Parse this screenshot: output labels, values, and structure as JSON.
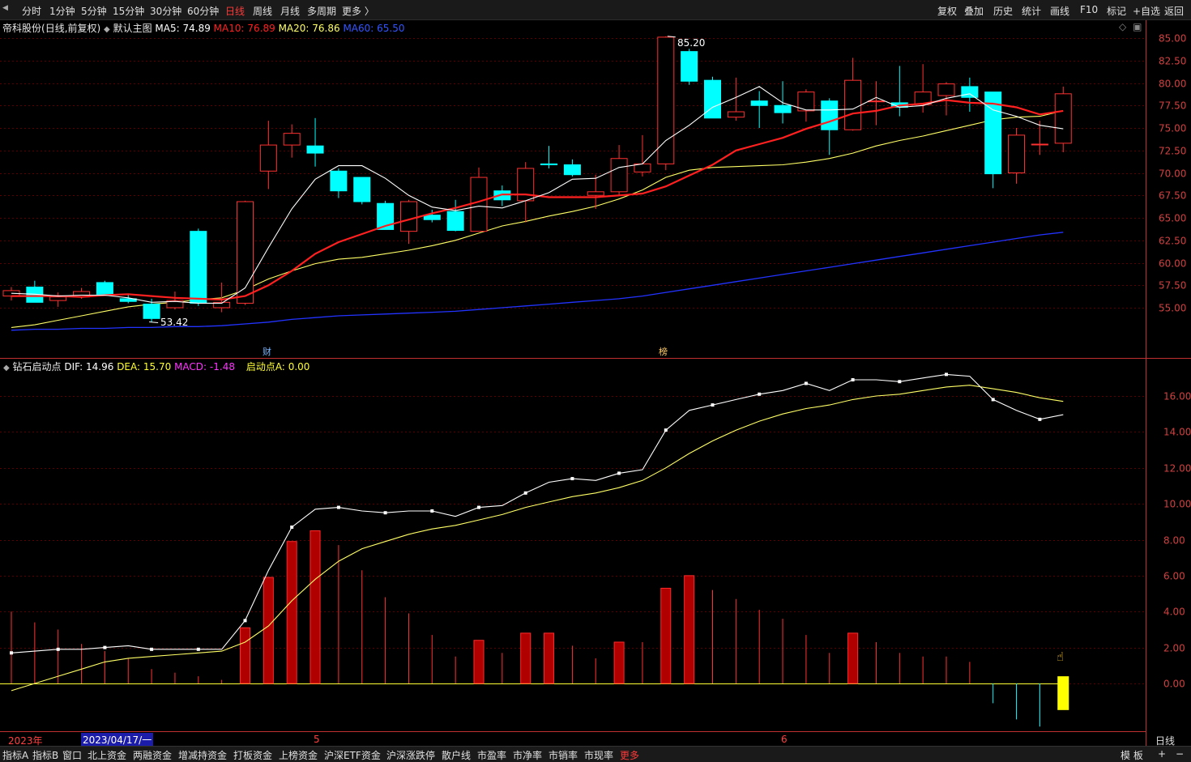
{
  "toolbar": {
    "periods": [
      "分时",
      "1分钟",
      "5分钟",
      "15分钟",
      "30分钟",
      "60分钟",
      "日线",
      "周线",
      "月线",
      "多周期",
      "更多 〉"
    ],
    "active_period": "日线",
    "tools": [
      "复权",
      "叠加",
      "历史",
      "统计",
      "画线",
      "F10",
      "标记",
      "+自选",
      "返回"
    ]
  },
  "main_chart": {
    "stock": "帝科股份",
    "mode": "(日线,前复权)",
    "template": "默认主图",
    "ma5": {
      "label": "MA5:",
      "value": "74.89",
      "color": "#ffffff"
    },
    "ma10": {
      "label": "MA10:",
      "value": "76.89",
      "color": "#ff2020"
    },
    "ma20": {
      "label": "MA20:",
      "value": "76.86",
      "color": "#ffff66"
    },
    "ma60": {
      "label": "MA60:",
      "value": "65.50",
      "color": "#2040ff"
    },
    "high_marker": "85.20",
    "low_marker": "53.42",
    "event_cai": "财",
    "event_bang": "榜"
  },
  "sub_chart": {
    "name": "钻石启动点",
    "dif": {
      "label": "DIF:",
      "value": "14.96",
      "color": "#ffffff"
    },
    "dea": {
      "label": "DEA:",
      "value": "15.70",
      "color": "#ffff33"
    },
    "macd": {
      "label": "MACD:",
      "value": "-1.48",
      "color": "#ff33ff"
    },
    "qidong": {
      "label": "启动点A:",
      "value": "0.00",
      "color": "#ffff33"
    }
  },
  "time_axis": {
    "year": "2023年",
    "cursor_date": "2023/04/17/一",
    "month5": "5",
    "month6": "6",
    "period_label": "日线"
  },
  "bottom_tabs": [
    "指标A",
    "指标B",
    "窗口",
    "北上资金",
    "两融资金",
    "增减持资金",
    "打板资金",
    "上榜资金",
    "沪深ETF资金",
    "沪深涨跌停",
    "散户线",
    "市盈率",
    "市净率",
    "市销率",
    "市现率",
    "更多"
  ],
  "bottom_right": [
    "模 板",
    "+",
    "−"
  ],
  "colors": {
    "up": "#ff3030",
    "down": "#00ffff",
    "bg": "#000000",
    "grid": "#5a0000",
    "axis": "#ff5555"
  },
  "chart_data": [
    {
      "type": "candlestick",
      "y_ticks": [
        55.0,
        57.5,
        60.0,
        62.5,
        65.0,
        67.5,
        70.0,
        72.5,
        75.0,
        77.5,
        80.0,
        82.5,
        85.0
      ],
      "ylim": [
        52.5,
        85.5
      ],
      "candles": [
        {
          "o": 56.3,
          "h": 57.3,
          "l": 55.8,
          "c": 56.9
        },
        {
          "o": 57.3,
          "h": 58.0,
          "l": 55.6,
          "c": 55.6
        },
        {
          "o": 55.8,
          "h": 56.7,
          "l": 55.1,
          "c": 56.2
        },
        {
          "o": 56.2,
          "h": 57.2,
          "l": 56.0,
          "c": 56.8
        },
        {
          "o": 57.8,
          "h": 58.0,
          "l": 56.4,
          "c": 56.5
        },
        {
          "o": 56.0,
          "h": 56.5,
          "l": 55.5,
          "c": 55.7
        },
        {
          "o": 55.4,
          "h": 56.0,
          "l": 53.4,
          "c": 53.8
        },
        {
          "o": 55.0,
          "h": 56.8,
          "l": 54.8,
          "c": 55.8
        },
        {
          "o": 63.5,
          "h": 63.8,
          "l": 55.2,
          "c": 55.5
        },
        {
          "o": 55.0,
          "h": 57.8,
          "l": 54.5,
          "c": 55.6
        },
        {
          "o": 55.5,
          "h": 66.9,
          "l": 55.3,
          "c": 66.8
        },
        {
          "o": 70.2,
          "h": 75.8,
          "l": 68.2,
          "c": 73.1
        },
        {
          "o": 73.1,
          "h": 75.4,
          "l": 71.7,
          "c": 74.4
        },
        {
          "o": 73.0,
          "h": 76.1,
          "l": 70.7,
          "c": 72.2
        },
        {
          "o": 70.2,
          "h": 70.5,
          "l": 67.2,
          "c": 68.0
        },
        {
          "o": 69.5,
          "h": 69.5,
          "l": 66.5,
          "c": 66.8
        },
        {
          "o": 66.6,
          "h": 66.9,
          "l": 63.7,
          "c": 63.7
        },
        {
          "o": 63.5,
          "h": 67.0,
          "l": 62.1,
          "c": 66.8
        },
        {
          "o": 65.3,
          "h": 65.9,
          "l": 64.5,
          "c": 64.8
        },
        {
          "o": 65.7,
          "h": 67.0,
          "l": 63.5,
          "c": 63.6
        },
        {
          "o": 63.5,
          "h": 70.6,
          "l": 63.5,
          "c": 69.5
        },
        {
          "o": 68.0,
          "h": 68.6,
          "l": 66.3,
          "c": 67.0
        },
        {
          "o": 66.9,
          "h": 71.2,
          "l": 64.5,
          "c": 70.5
        },
        {
          "o": 71.0,
          "h": 73.0,
          "l": 70.5,
          "c": 70.9
        },
        {
          "o": 70.9,
          "h": 71.5,
          "l": 69.6,
          "c": 69.8
        },
        {
          "o": 67.5,
          "h": 69.8,
          "l": 66.0,
          "c": 67.9
        },
        {
          "o": 67.9,
          "h": 73.1,
          "l": 67.5,
          "c": 71.6
        },
        {
          "o": 70.1,
          "h": 74.2,
          "l": 69.6,
          "c": 71.0
        },
        {
          "o": 71.0,
          "h": 85.2,
          "l": 70.3,
          "c": 85.1
        },
        {
          "o": 83.5,
          "h": 83.8,
          "l": 79.8,
          "c": 80.2
        },
        {
          "o": 80.3,
          "h": 80.7,
          "l": 76.1,
          "c": 76.1
        },
        {
          "o": 76.2,
          "h": 80.6,
          "l": 75.8,
          "c": 76.8
        },
        {
          "o": 78.0,
          "h": 79.1,
          "l": 75.0,
          "c": 77.5
        },
        {
          "o": 77.5,
          "h": 80.2,
          "l": 75.5,
          "c": 76.7
        },
        {
          "o": 76.9,
          "h": 79.3,
          "l": 75.7,
          "c": 79.0
        },
        {
          "o": 78.0,
          "h": 78.3,
          "l": 72.0,
          "c": 74.8
        },
        {
          "o": 74.8,
          "h": 82.8,
          "l": 74.7,
          "c": 80.3
        },
        {
          "o": 78.0,
          "h": 80.2,
          "l": 75.3,
          "c": 78.0
        },
        {
          "o": 77.8,
          "h": 81.9,
          "l": 76.3,
          "c": 77.3
        },
        {
          "o": 77.6,
          "h": 82.1,
          "l": 76.7,
          "c": 79.0
        },
        {
          "o": 78.6,
          "h": 80.1,
          "l": 76.4,
          "c": 79.9
        },
        {
          "o": 79.6,
          "h": 80.6,
          "l": 76.8,
          "c": 78.4
        },
        {
          "o": 79.0,
          "h": 79.0,
          "l": 68.3,
          "c": 69.9
        },
        {
          "o": 70.0,
          "h": 75.0,
          "l": 68.8,
          "c": 74.2
        },
        {
          "o": 73.2,
          "h": 75.8,
          "l": 72.0,
          "c": 73.2
        },
        {
          "o": 73.3,
          "h": 79.6,
          "l": 72.3,
          "c": 78.8
        }
      ],
      "ma5": [
        56.6,
        56.5,
        56.3,
        56.4,
        56.4,
        56.1,
        55.6,
        55.7,
        55.5,
        55.5,
        57.2,
        61.7,
        66.0,
        69.3,
        70.8,
        70.8,
        69.4,
        67.5,
        66.2,
        65.8,
        66.3,
        66.1,
        66.9,
        67.8,
        69.3,
        69.4,
        70.6,
        71.0,
        73.6,
        75.3,
        77.3,
        78.4,
        79.6,
        77.8,
        77.0,
        77.0,
        77.1,
        78.4,
        77.3,
        77.5,
        78.3,
        78.8,
        77.0,
        76.3,
        75.3,
        74.9
      ],
      "ma10": [
        56.3,
        56.3,
        56.3,
        56.2,
        56.4,
        56.5,
        56.3,
        56.1,
        56.0,
        55.9,
        56.3,
        57.5,
        59.1,
        61.0,
        62.3,
        63.2,
        64.1,
        64.8,
        65.5,
        66.1,
        66.8,
        67.6,
        67.6,
        67.3,
        67.3,
        67.3,
        67.5,
        67.7,
        68.5,
        69.7,
        70.9,
        72.5,
        73.2,
        73.9,
        74.9,
        75.7,
        76.6,
        76.9,
        77.5,
        77.7,
        78.1,
        77.8,
        77.7,
        77.3,
        76.5,
        76.9
      ],
      "ma20": [
        52.8,
        53.1,
        53.6,
        54.1,
        54.6,
        55.1,
        55.4,
        55.6,
        55.9,
        56.1,
        57.0,
        58.2,
        59.1,
        59.9,
        60.4,
        60.6,
        61.0,
        61.4,
        61.9,
        62.5,
        63.3,
        64.1,
        64.6,
        65.2,
        65.7,
        66.3,
        67.1,
        68.1,
        69.5,
        70.3,
        70.6,
        70.7,
        70.8,
        70.9,
        71.2,
        71.6,
        72.2,
        73.0,
        73.6,
        74.1,
        74.7,
        75.3,
        75.9,
        76.2,
        76.3,
        76.9
      ],
      "ma60": [
        52.5,
        52.6,
        52.6,
        52.7,
        52.7,
        52.8,
        52.8,
        52.9,
        52.9,
        53.0,
        53.2,
        53.4,
        53.7,
        53.9,
        54.1,
        54.2,
        54.3,
        54.4,
        54.5,
        54.6,
        54.8,
        55.0,
        55.2,
        55.4,
        55.6,
        55.8,
        56.0,
        56.3,
        56.7,
        57.1,
        57.5,
        57.9,
        58.3,
        58.7,
        59.1,
        59.5,
        59.9,
        60.3,
        60.7,
        61.1,
        61.5,
        61.9,
        62.3,
        62.7,
        63.1,
        63.4
      ]
    },
    {
      "type": "macd",
      "y_ticks": [
        0,
        2,
        4,
        6,
        8,
        10,
        12,
        14,
        16
      ],
      "ylim": [
        -2.3,
        17.8
      ],
      "dif": [
        1.7,
        1.8,
        1.9,
        1.9,
        2.0,
        2.1,
        1.9,
        1.9,
        1.9,
        1.9,
        3.5,
        6.3,
        8.7,
        9.7,
        9.8,
        9.6,
        9.5,
        9.6,
        9.6,
        9.3,
        9.8,
        9.9,
        10.6,
        11.2,
        11.4,
        11.3,
        11.7,
        11.9,
        14.1,
        15.2,
        15.5,
        15.8,
        16.1,
        16.3,
        16.7,
        16.3,
        16.9,
        16.9,
        16.8,
        17.0,
        17.2,
        17.1,
        15.8,
        15.2,
        14.7,
        14.96
      ],
      "dea": [
        -0.4,
        0.0,
        0.4,
        0.8,
        1.2,
        1.4,
        1.5,
        1.6,
        1.7,
        1.8,
        2.3,
        3.2,
        4.6,
        5.8,
        6.8,
        7.5,
        7.9,
        8.3,
        8.6,
        8.8,
        9.1,
        9.4,
        9.8,
        10.1,
        10.4,
        10.6,
        10.9,
        11.3,
        12.0,
        12.8,
        13.5,
        14.1,
        14.6,
        15.0,
        15.3,
        15.5,
        15.8,
        16.0,
        16.1,
        16.3,
        16.5,
        16.6,
        16.4,
        16.2,
        15.9,
        15.7
      ],
      "macd": [
        4.0,
        3.4,
        3.0,
        2.2,
        1.8,
        1.4,
        0.8,
        0.6,
        0.4,
        0.2,
        3.1,
        5.9,
        7.9,
        8.5,
        7.7,
        6.3,
        4.8,
        3.9,
        2.7,
        1.5,
        2.4,
        1.7,
        2.8,
        2.8,
        2.1,
        1.4,
        2.3,
        2.3,
        5.3,
        6.0,
        5.2,
        4.7,
        4.1,
        3.6,
        2.7,
        1.7,
        2.8,
        2.3,
        1.7,
        1.5,
        1.5,
        1.2,
        -1.1,
        -2.0,
        -2.4,
        -1.48
      ]
    }
  ]
}
